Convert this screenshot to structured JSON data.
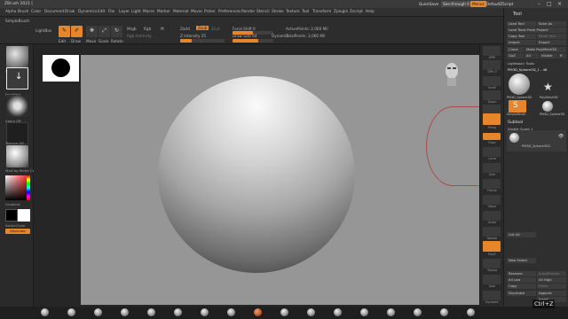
{
  "app": {
    "title": "ZBrush 2021 ["
  },
  "menu": {
    "items": [
      "Alpha",
      "Brush",
      "Color",
      "Document",
      "Draw",
      "Dynamics",
      "Edit",
      "File",
      "Layer",
      "Light",
      "Macro",
      "Marker",
      "Material",
      "Movie",
      "Picker",
      "Preferences",
      "Render",
      "Stencil",
      "Stroke",
      "Texture",
      "Tool",
      "Transform",
      "Zplugin",
      "Zscript",
      "Help"
    ]
  },
  "quick": {
    "quicksave": "QuickSave",
    "see_through": "See-through",
    "see_through_value": "0",
    "menus": "Menus",
    "script": "DefaultZScript"
  },
  "toolbar": {
    "subpalette": "SimpleBrush",
    "lightbox": "LightBox",
    "edit": "Edit",
    "draw": "Draw",
    "move": "Move",
    "scale": "Scale",
    "rotate": "Rotate",
    "mrgb": "Mrgb",
    "rgb": "Rgb",
    "m": "M",
    "zadd": "Zadd",
    "zsub": "Zsub",
    "zcut": "Zcut",
    "rgb_intensity": "Rgb Intensity",
    "z_intensity": "Z Intensity 25",
    "focal_shift": "Focal Shift 0",
    "draw_size": "Draw Size 64",
    "dynamic": "Dynamic",
    "active_points": "ActivePoints: 2,060 Mil",
    "total_points": "TotalPoints: 2,060 Mil"
  },
  "left_shelf": {
    "brush_label": "Standard",
    "stroke_label": "DragRect",
    "alpha_label": "Alpha Off",
    "texture_label": "Texture Off",
    "material_label": "MatCap White Cavity",
    "gradient": "Gradient",
    "switch_color": "SwitchColor",
    "alternate": "Alternate"
  },
  "right_shelf": {
    "buttons": [
      "BPR",
      "SPix 3",
      "Scroll",
      "Zoom",
      "Actual",
      "AAHalf",
      "Persp",
      "Floor",
      "Local",
      "Sym",
      "Frame",
      "Move",
      "Scale",
      "Rotate",
      "PolyF",
      "Transp",
      "Solo",
      "Dynamic"
    ]
  },
  "tray": {
    "title": "Tool",
    "load_tool": "Load Tool",
    "save_as": "Save As",
    "load_tools_from_project": "Load Tools From Project",
    "copy_tool": "Copy Tool",
    "paste_tool": "Paste Tool",
    "import": "Import",
    "export": "Export",
    "clone": "Clone",
    "make_polymesh": "Make PolyMesh3D",
    "goz": "GoZ",
    "all": "All",
    "visible": "Visible",
    "r": "R",
    "lightbox_tools": "Lightbox> Tools",
    "current_tool": "PM3D_Sphere3D_1 - 48",
    "thumb_labels": [
      "PM3D_Sphere3D",
      "PolyMesh3D",
      "SimpleBrush",
      "PM3D_Sphere3D"
    ],
    "subtool": "Subtool",
    "visible_count": "Visible Count 1",
    "subtool_item": "PM3D_Sphere3D1",
    "list_all": "List All",
    "new_folder": "New Folder",
    "rename": "Rename",
    "autoreorder": "AutoReorder",
    "all_low": "All Low",
    "all_high": "All High",
    "copy": "Copy",
    "paste": "Paste",
    "duplicate": "Duplicate",
    "append": "Append",
    "insert": "Insert",
    "delete": "Delete",
    "del_other": "Del Other",
    "del_all": "Del All",
    "split": "Split",
    "merge": "Merge"
  },
  "watermark": "Ctrl+Z",
  "colors": {
    "accent": "#e7852b",
    "canvas": "#969696",
    "ui_bg": "#2a2a2a"
  }
}
